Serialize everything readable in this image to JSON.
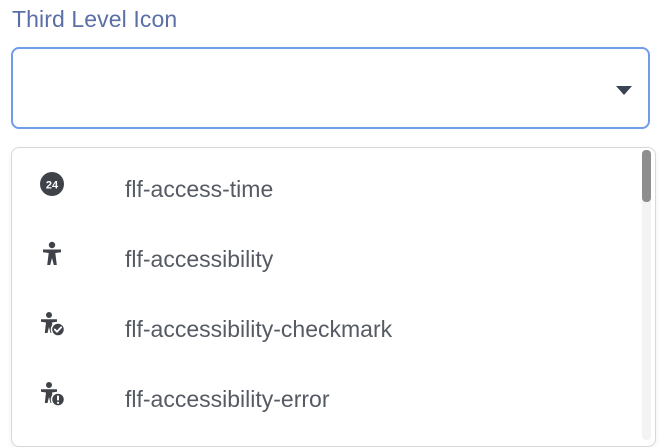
{
  "field": {
    "label": "Third Level Icon",
    "value": ""
  },
  "dropdown": {
    "options": [
      {
        "label": "flf-access-time",
        "icon": "access-time-24-icon",
        "badge": "24"
      },
      {
        "label": "flf-accessibility",
        "icon": "accessibility-icon"
      },
      {
        "label": "flf-accessibility-checkmark",
        "icon": "accessibility-checkmark-icon"
      },
      {
        "label": "flf-accessibility-error",
        "icon": "accessibility-error-icon"
      }
    ]
  },
  "colors": {
    "label": "#5b6fa6",
    "focus_border": "#6f9de9",
    "icon": "#3f4249",
    "option_text": "#555a63"
  }
}
